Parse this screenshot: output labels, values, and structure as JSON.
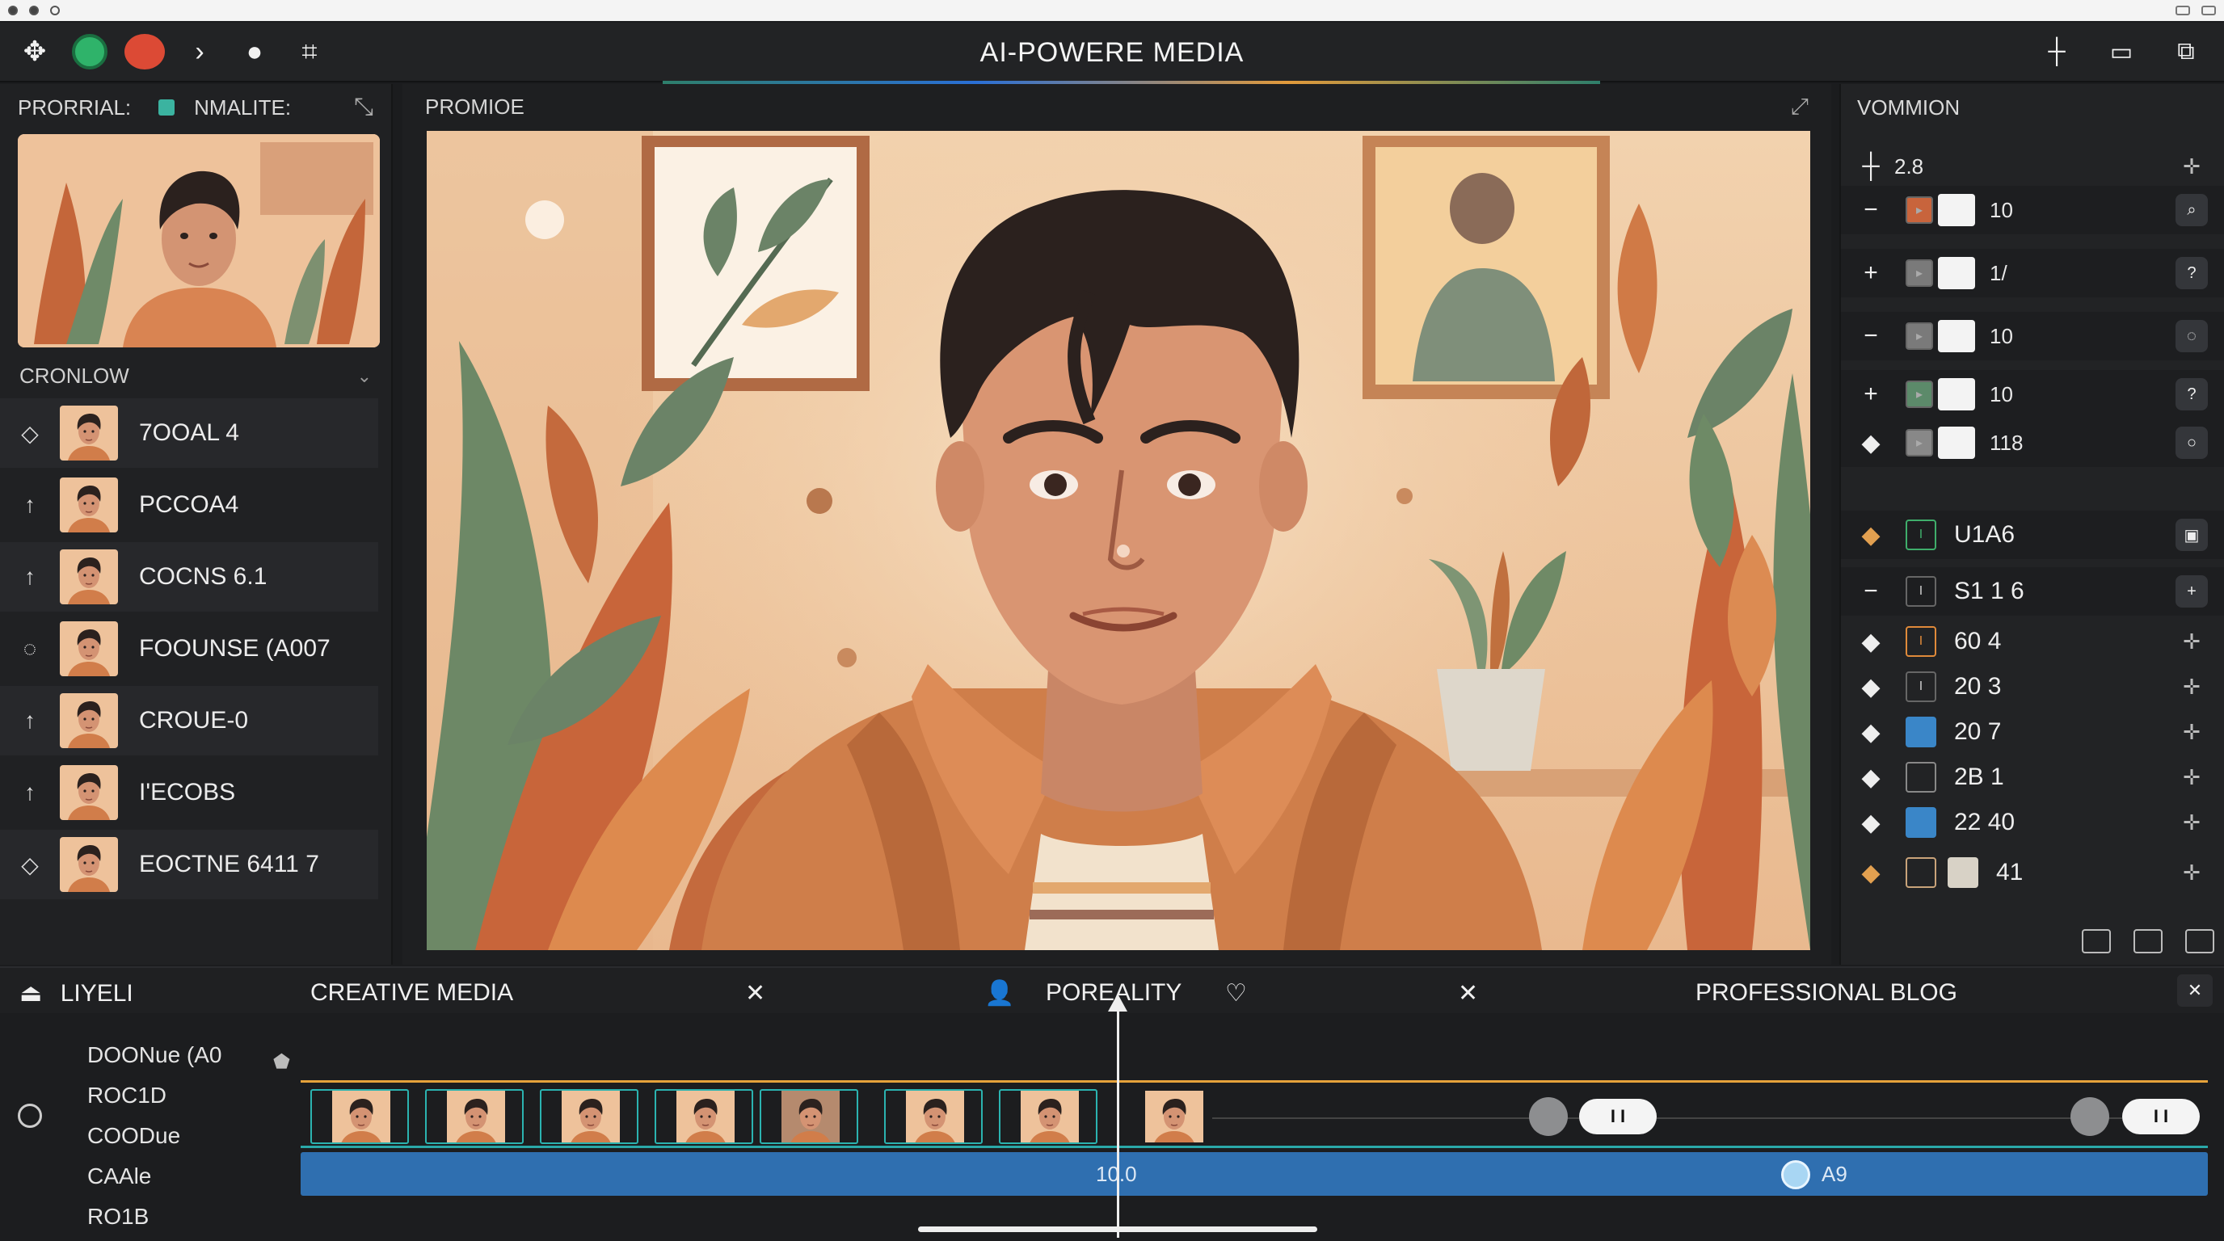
{
  "app": {
    "title": "AI-POWERE MEDIA"
  },
  "left": {
    "header_a": "PRORRIAL:",
    "header_b": "NMALITE:",
    "section": "CRONLOW",
    "layers": [
      {
        "icon": "◇",
        "name": "7OOAL 4"
      },
      {
        "icon": "↑",
        "name": "PCCOA4"
      },
      {
        "icon": "↑",
        "name": "COCNS 6.1"
      },
      {
        "icon": "◌",
        "name": "FOOUNSE (A007"
      },
      {
        "icon": "↑",
        "name": "CROUE-0"
      },
      {
        "icon": "↑",
        "name": "I'ECOBS"
      },
      {
        "icon": "◇",
        "name": "EOCTNE 6411 7"
      }
    ]
  },
  "center": {
    "title": "PROMIOE"
  },
  "right": {
    "title": "VOMMION",
    "top_value": "2.8",
    "rows_a": [
      {
        "ctl": "−",
        "value": "10",
        "swatch": "#c8643c"
      },
      {
        "ctl": "+",
        "value": "1/",
        "swatch": "#7a7a7a"
      },
      {
        "ctl": "−",
        "value": "10",
        "swatch": "#7a7a7a"
      },
      {
        "ctl": "+",
        "value": "10",
        "swatch": "#5c8a6a"
      },
      {
        "ctl": "◆",
        "value": "118",
        "swatch": "#888"
      }
    ],
    "rows_b": [
      {
        "ctl": "◆",
        "value": "U1A6"
      },
      {
        "ctl": "−",
        "value": "S1 1 6"
      },
      {
        "ctl": "◆",
        "value": "60 4"
      },
      {
        "ctl": "◆",
        "value": "20 3"
      },
      {
        "ctl": "◆",
        "value": "20 7"
      },
      {
        "ctl": "◆",
        "value": "2B 1"
      },
      {
        "ctl": "◆",
        "value": "22 40"
      },
      {
        "ctl": "◆",
        "value": "41"
      }
    ]
  },
  "timeline": {
    "lead": "LIYELI",
    "tab1": "CREATIVE MEDIA",
    "tab2": "POREALITY",
    "tab3": "PROFESSIONAL BLOG",
    "tracks": [
      "DOONue (A0",
      "ROC1D",
      "COODue",
      "CAAle",
      "RO1B"
    ],
    "bar_label": "10.0",
    "bar_label2": "A9",
    "pill1": "I I",
    "pill2": "I I"
  },
  "colors": {
    "accent_green": "#2fb36a",
    "accent_red": "#dc4a35",
    "timeline_blue": "#2f6fb0",
    "teal": "#2aa8a8",
    "orange": "#e5a23b"
  }
}
